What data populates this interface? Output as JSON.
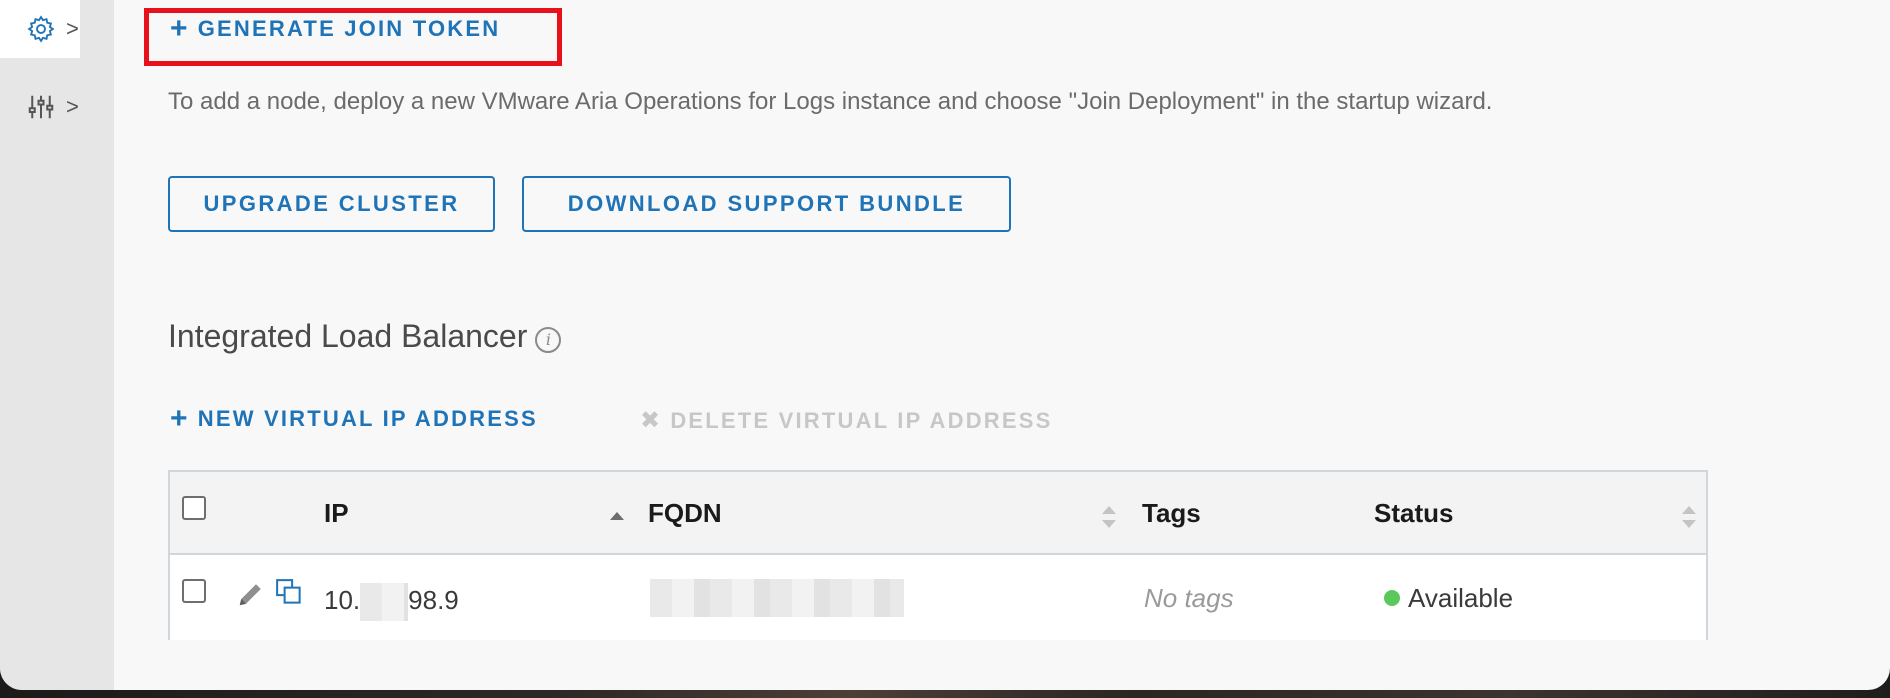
{
  "sidebar": {
    "items": [
      {
        "icon": "gear-icon",
        "chevron": ">"
      },
      {
        "icon": "sliders-icon",
        "chevron": ">"
      }
    ]
  },
  "actions": {
    "generate_join_token": "GENERATE JOIN TOKEN",
    "plus": "+",
    "help_text": "To add a node, deploy a new VMware Aria Operations for Logs instance and choose \"Join Deployment\" in the startup wizard.",
    "upgrade_cluster": "UPGRADE CLUSTER",
    "download_support_bundle": "DOWNLOAD SUPPORT BUNDLE"
  },
  "load_balancer": {
    "title": "Integrated Load Balancer",
    "info_icon": "i",
    "new_vip": "NEW VIRTUAL IP ADDRESS",
    "delete_vip": "DELETE VIRTUAL IP ADDRESS",
    "delete_icon": "✖",
    "table": {
      "columns": [
        "IP",
        "FQDN",
        "Tags",
        "Status"
      ],
      "rows": [
        {
          "ip_prefix": "10.",
          "ip_suffix": "98.9",
          "tags": "No tags",
          "status": "Available"
        }
      ]
    }
  },
  "colors": {
    "accent": "#1f73b7",
    "highlight": "#e8111b",
    "status_available": "#5bc85b"
  }
}
